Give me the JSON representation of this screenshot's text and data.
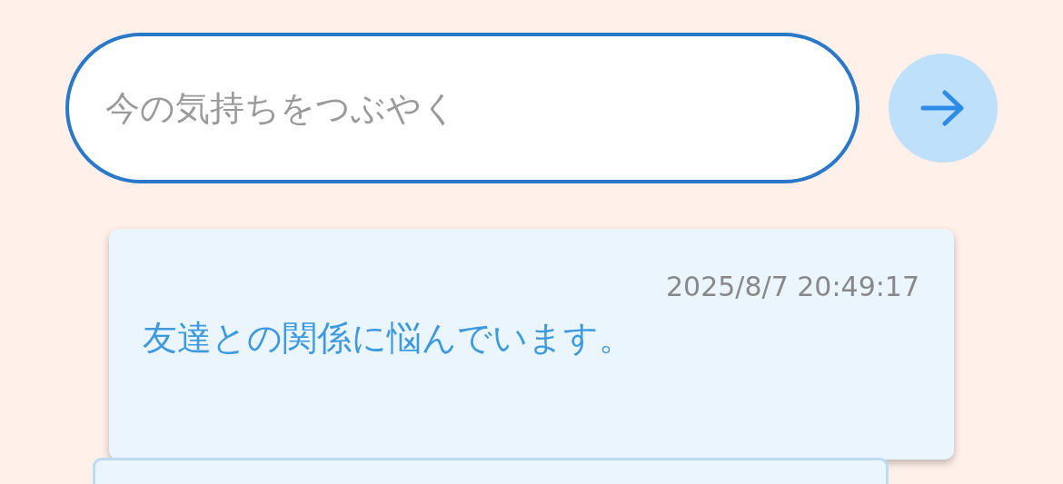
{
  "composer": {
    "placeholder": "今の気持ちをつぶやく"
  },
  "posts": [
    {
      "timestamp": "2025/8/7 20:49:17",
      "text": "友達との関係に悩んでいます。"
    }
  ]
}
